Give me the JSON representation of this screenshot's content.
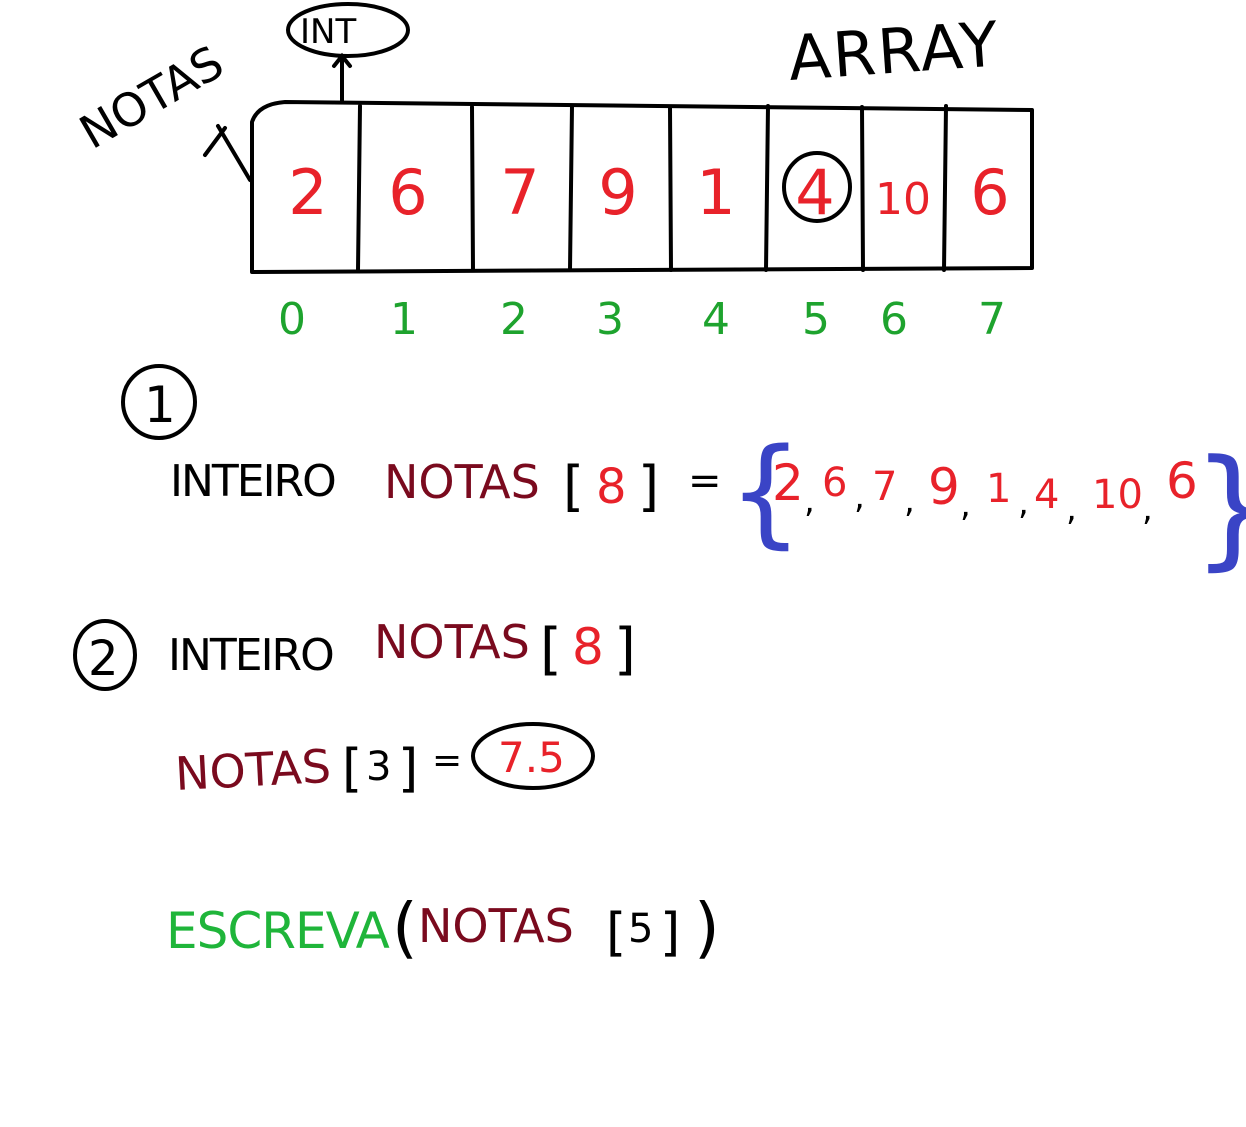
{
  "colors": {
    "ink": "#000000",
    "values": "#e8222a",
    "indices": "#1ea32e",
    "varname": "#7a0a1e",
    "brace": "#3a44c6",
    "keyword_green": "#1fb53a"
  },
  "labels": {
    "array_title": "ARRAY",
    "type_label": "INT",
    "array_name": "NOTAS"
  },
  "array": {
    "values": [
      "2",
      "6",
      "7",
      "9",
      "1",
      "4",
      "10",
      "6"
    ],
    "indices": [
      "0",
      "1",
      "2",
      "3",
      "4",
      "5",
      "6",
      "7"
    ],
    "circled_index": 5
  },
  "section1": {
    "number": "1",
    "keyword": "INTEIRO",
    "varname": "NOTAS",
    "size": "8",
    "equals": "=",
    "open_brace": "{",
    "close_brace": "}",
    "values": [
      "2",
      "6",
      "7",
      "9",
      "1",
      "4",
      "10",
      "6"
    ]
  },
  "section2": {
    "number": "2",
    "keyword": "INTEIRO",
    "varname": "NOTAS",
    "size": "8",
    "assign_varname": "NOTAS",
    "assign_index": "3",
    "equals": "=",
    "assign_value": "7.5"
  },
  "section3": {
    "func": "ESCREVA",
    "open_paren": "(",
    "varname": "NOTAS",
    "index": "5",
    "close_paren": ")"
  }
}
